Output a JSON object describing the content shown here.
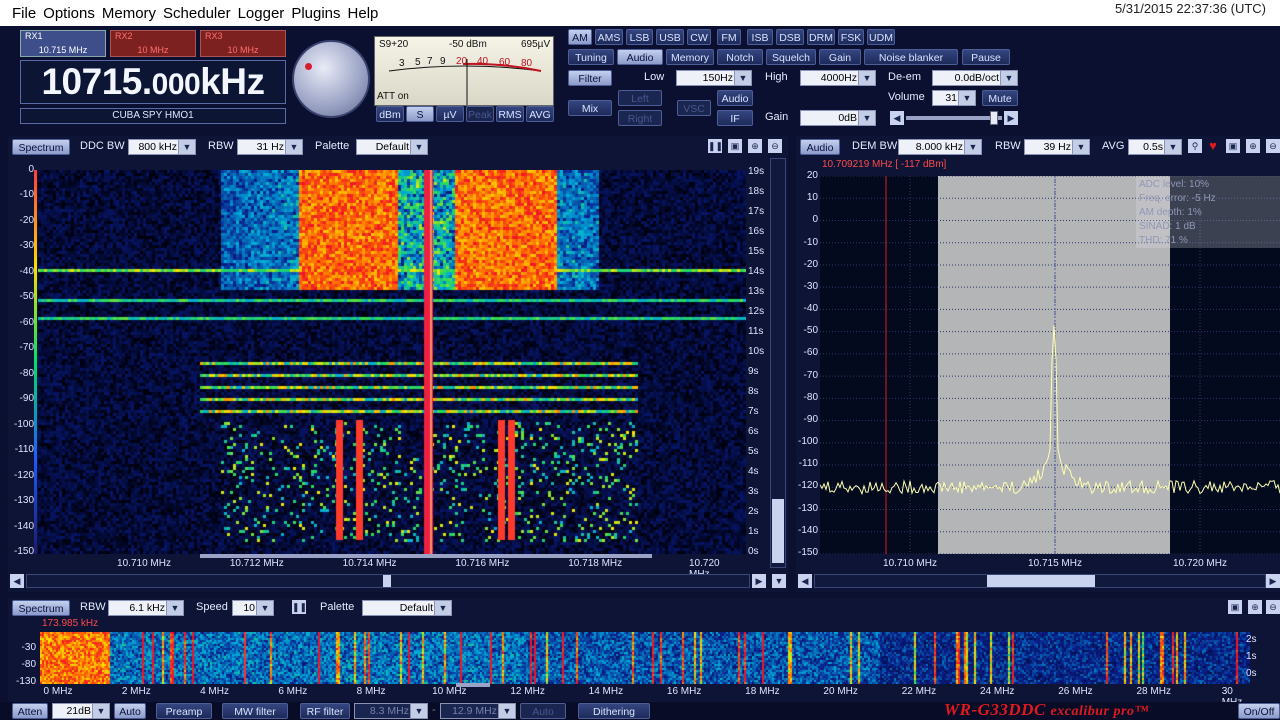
{
  "menu": [
    "File",
    "Options",
    "Memory",
    "Scheduler",
    "Logger",
    "Plugins",
    "Help"
  ],
  "clock": "5/31/2015 22:37:36 (UTC)",
  "receivers": [
    {
      "name": "RX1",
      "freq": "10.715 MHz",
      "active": true
    },
    {
      "name": "RX2",
      "freq": "10 MHz",
      "active": false
    },
    {
      "name": "RX3",
      "freq": "10 MHz",
      "active": false
    }
  ],
  "frequency": {
    "main": "10715.",
    "decimals": "000",
    "unit": "kHz"
  },
  "station": "CUBA SPY HMO1",
  "smeter": {
    "level": "S9+20",
    "dbm": "-50 dBm",
    "uv": "695µV",
    "att": "ATT on",
    "scale": [
      "3",
      "5",
      "7",
      "9",
      "20",
      "40",
      "60",
      "80"
    ]
  },
  "meter_buttons": [
    "dBm",
    "S",
    "µV",
    "Peak",
    "RMS",
    "AVG"
  ],
  "modes": [
    "AM",
    "AMS",
    "LSB",
    "USB",
    "CW",
    "FM",
    "ISB",
    "DSB",
    "DRM",
    "FSK",
    "UDM"
  ],
  "tabs": [
    "Tuning",
    "Audio",
    "Memory",
    "Notch",
    "Squelch",
    "Gain",
    "Noise blanker",
    "Pause"
  ],
  "audio": {
    "filter": "Filter",
    "mix": "Mix",
    "left": "Left",
    "right": "Right",
    "vsc": "VSC",
    "audio": "Audio",
    "if": "IF",
    "low_label": "Low",
    "low": "150Hz",
    "high_label": "High",
    "high": "4000Hz",
    "gain_label": "Gain",
    "gain": "0dB",
    "deem_label": "De-em",
    "deem": "0.0dB/oct",
    "volume_label": "Volume",
    "volume": "31",
    "mute": "Mute"
  },
  "ddc": {
    "spectrum": "Spectrum",
    "bw_label": "DDC BW",
    "bw": "800 kHz",
    "rbw_label": "RBW",
    "rbw": "31 Hz",
    "palette_label": "Palette",
    "palette": "Default",
    "db_ticks": [
      "0",
      "-10",
      "-20",
      "-30",
      "-40",
      "-50",
      "-60",
      "-70",
      "-80",
      "-90",
      "-100",
      "-110",
      "-120",
      "-130",
      "-140",
      "-150"
    ],
    "time_ticks": [
      "19s",
      "18s",
      "17s",
      "16s",
      "15s",
      "14s",
      "13s",
      "12s",
      "11s",
      "10s",
      "9s",
      "8s",
      "7s",
      "6s",
      "5s",
      "4s",
      "3s",
      "2s",
      "1s",
      "0s"
    ],
    "freq_ticks": [
      "10.710 MHz",
      "10.712 MHz",
      "10.714 MHz",
      "10.716 MHz",
      "10.718 MHz",
      "10.720 MHz"
    ]
  },
  "audio_spectrum": {
    "tab": "Audio",
    "dem_label": "DEM BW",
    "dem_bw": "8.000 kHz",
    "rbw_label": "RBW",
    "rbw": "39 Hz",
    "avg_label": "AVG",
    "avg": "0.5s",
    "marker": "10.709219 MHz [ -117 dBm]",
    "db_ticks": [
      "20",
      "10",
      "0",
      "-10",
      "-20",
      "-30",
      "-40",
      "-50",
      "-60",
      "-70",
      "-80",
      "-90",
      "-100",
      "-110",
      "-120",
      "-130",
      "-140",
      "-150"
    ],
    "freq_ticks": [
      "10.710 MHz",
      "10.715 MHz",
      "10.720 MHz"
    ],
    "info": [
      "ADC level: 10%",
      "Freq. error: -5 Hz",
      "AM depth: 1%",
      "SINAD: 1 dB",
      "THD: 71 %"
    ]
  },
  "wideband": {
    "spectrum": "Spectrum",
    "rbw_label": "RBW",
    "rbw": "6.1 kHz",
    "speed_label": "Speed",
    "speed": "10",
    "palette_label": "Palette",
    "palette": "Default",
    "marker": "173.985 kHz",
    "db_ticks": [
      "-30",
      "-80",
      "-130"
    ],
    "time_ticks": [
      "2s",
      "1s",
      "0s"
    ],
    "freq_ticks": [
      "0 MHz",
      "2 MHz",
      "4 MHz",
      "6 MHz",
      "8 MHz",
      "10 MHz",
      "12 MHz",
      "14 MHz",
      "16 MHz",
      "18 MHz",
      "20 MHz",
      "22 MHz",
      "24 MHz",
      "26 MHz",
      "28 MHz",
      "30 MHz"
    ]
  },
  "bottombar": {
    "atten": "Atten",
    "atten_val": "21dB",
    "auto": "Auto",
    "preamp": "Preamp",
    "mw": "MW filter",
    "rf": "RF filter",
    "rf_lo": "8.3 MHz",
    "rf_hi": "12.9 MHz",
    "auto2": "Auto",
    "dithering": "Dithering",
    "onoff": "On/Off"
  },
  "brand": {
    "model": "WR-G33DDC",
    "series": "excalibur pro",
    "tm": "™"
  },
  "colors": {
    "background": "#0b1030",
    "accent": "#e0191f",
    "trace": "#ffffb0"
  }
}
